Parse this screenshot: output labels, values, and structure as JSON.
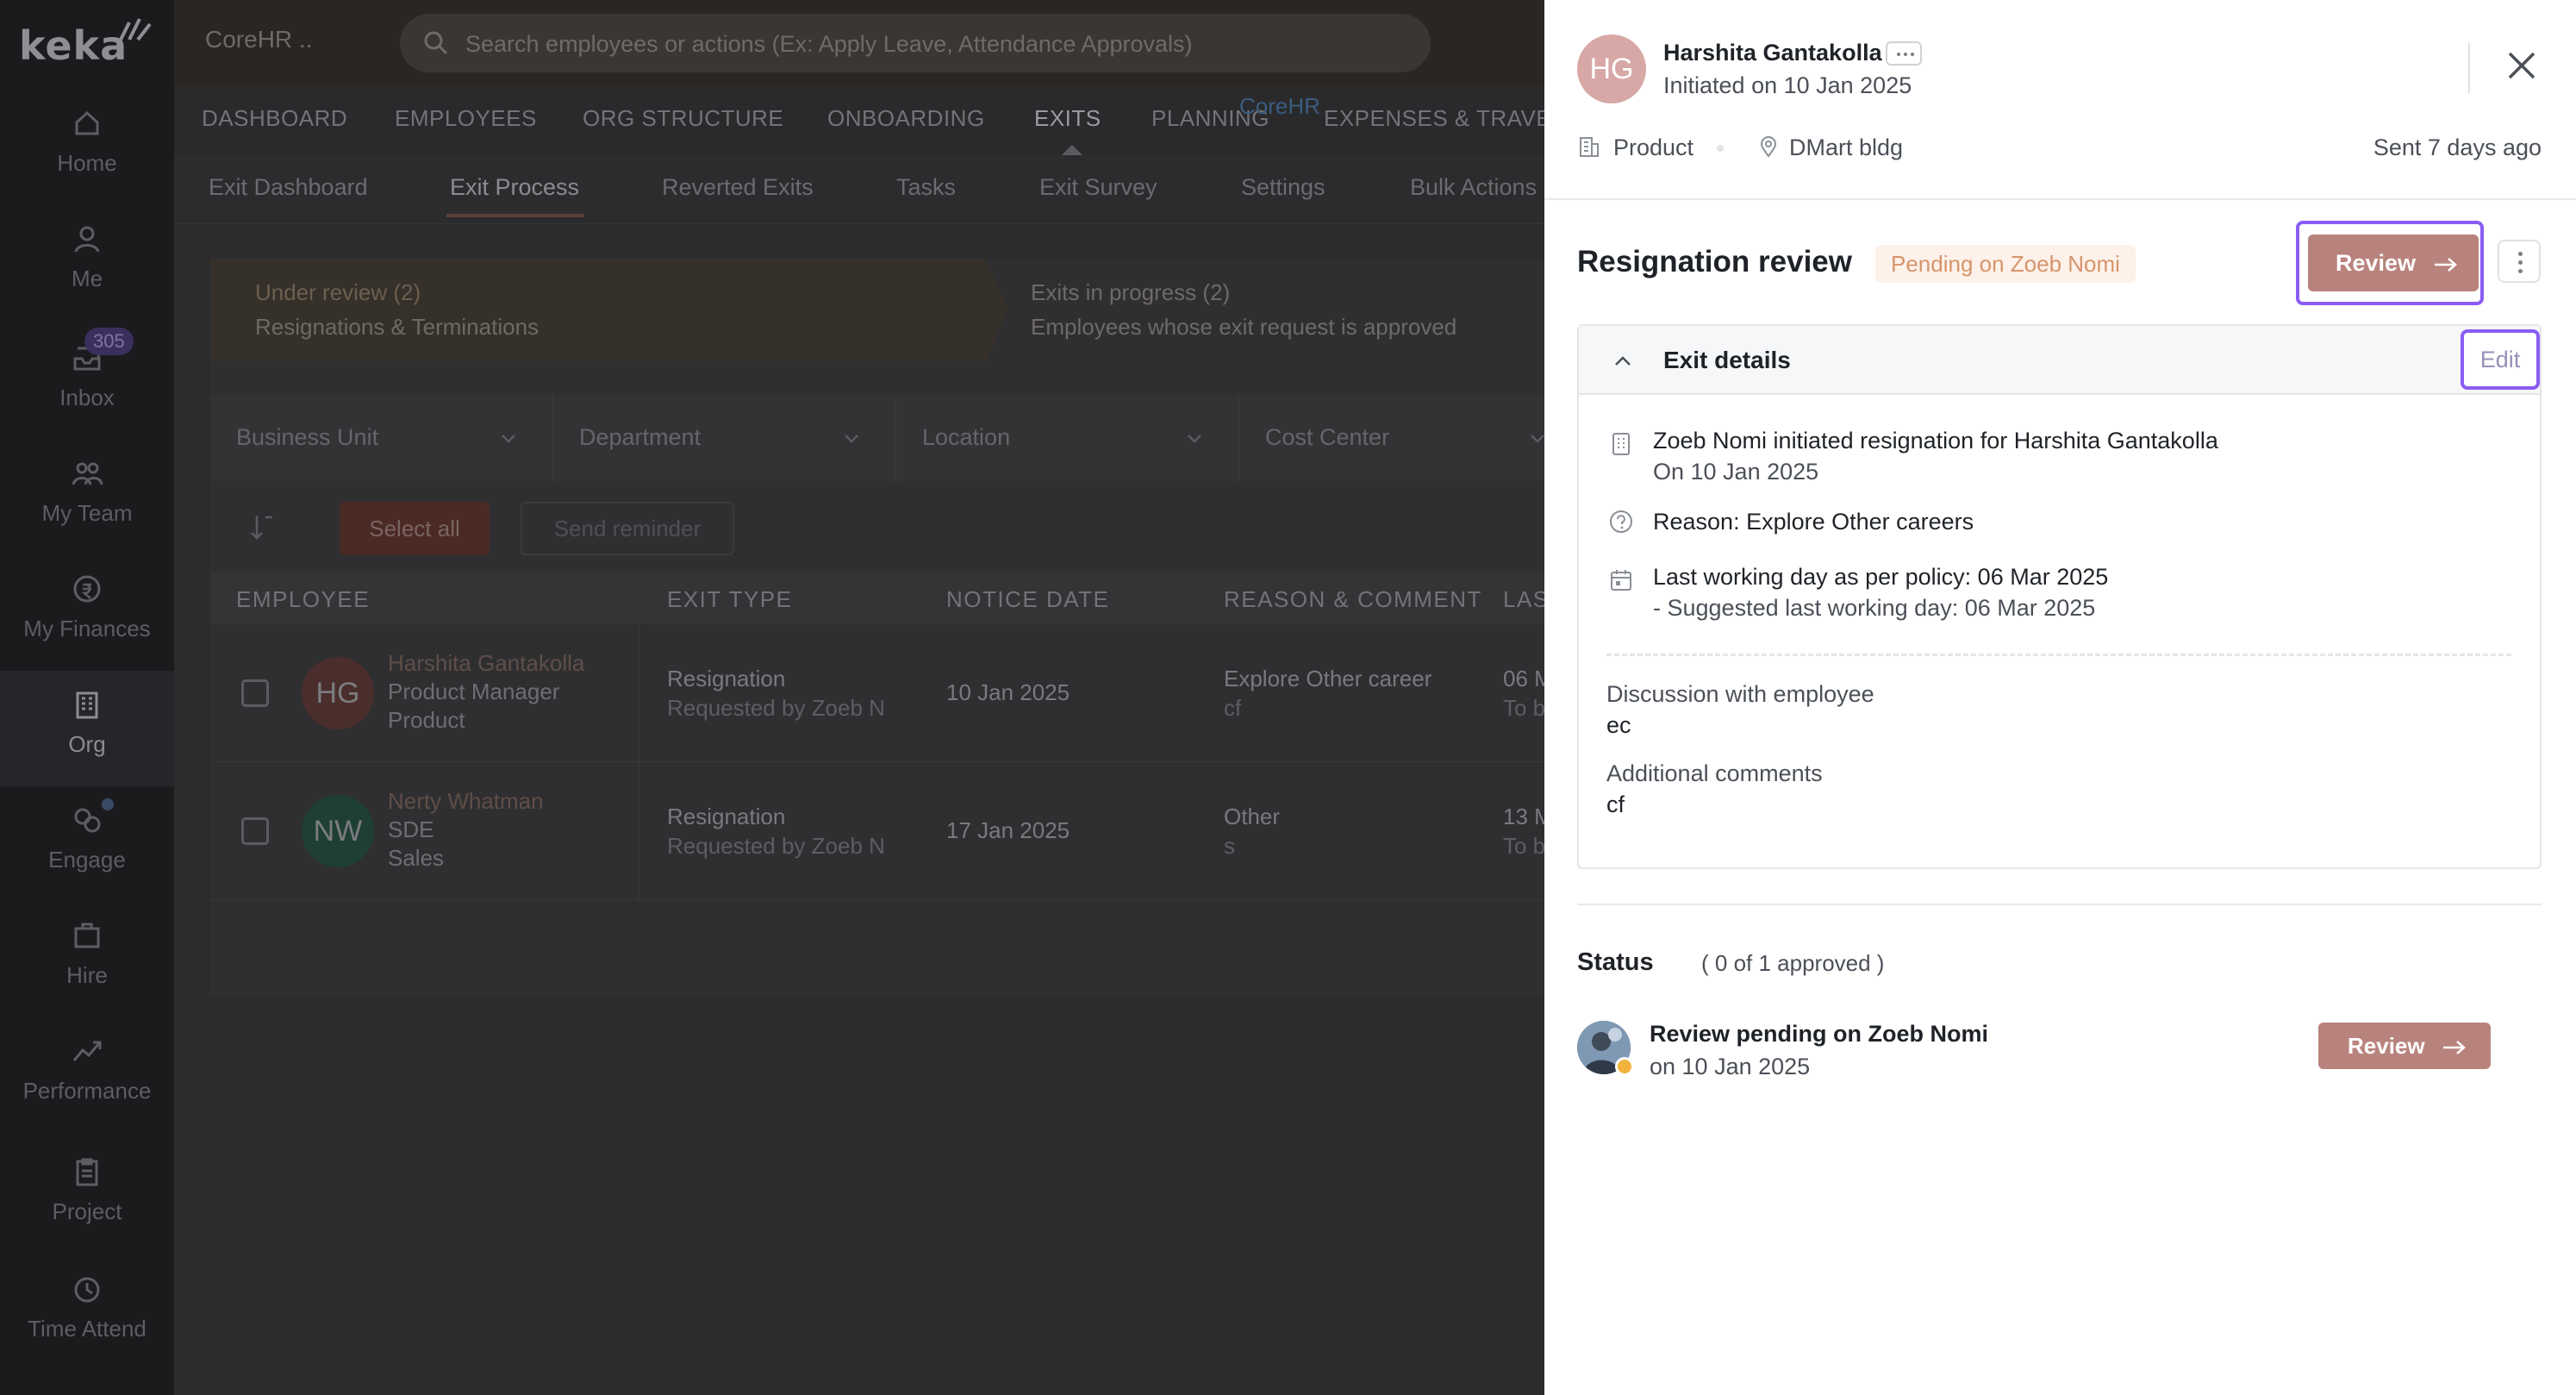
{
  "app": {
    "logo_text": "keka",
    "module_name": "CoreHR ..",
    "search_placeholder": "Search employees or actions (Ex: Apply Leave, Attendance Approvals)"
  },
  "rail": [
    {
      "label": "Home",
      "icon": "home-icon"
    },
    {
      "label": "Me",
      "icon": "user-icon"
    },
    {
      "label": "Inbox",
      "icon": "inbox-icon",
      "badge": "305"
    },
    {
      "label": "My Team",
      "icon": "team-icon"
    },
    {
      "label": "My Finances",
      "icon": "finance-icon"
    },
    {
      "label": "Org",
      "icon": "org-icon",
      "active": true
    },
    {
      "label": "Engage",
      "icon": "engage-icon"
    },
    {
      "label": "Hire",
      "icon": "hire-icon"
    },
    {
      "label": "Performance",
      "icon": "performance-icon"
    },
    {
      "label": "Project",
      "icon": "project-icon"
    },
    {
      "label": "Time Attend",
      "icon": "clock-icon"
    }
  ],
  "main_nav": {
    "items": [
      "DASHBOARD",
      "EMPLOYEES",
      "ORG STRUCTURE",
      "ONBOARDING",
      "EXITS",
      "PLANNING",
      "EXPENSES & TRAVEL"
    ],
    "active": "EXITS",
    "floating_label": "CoreHR"
  },
  "sub_nav": {
    "items": [
      "Exit Dashboard",
      "Exit Process",
      "Reverted Exits",
      "Tasks",
      "Exit Survey",
      "Settings",
      "Bulk Actions"
    ],
    "active": "Exit Process"
  },
  "stages": [
    {
      "title": "Under review (2)",
      "subtitle": "Resignations & Terminations"
    },
    {
      "title": "Exits in progress (2)",
      "subtitle": "Employees whose exit request is approved"
    }
  ],
  "filters": [
    "Business Unit",
    "Department",
    "Location",
    "Cost Center"
  ],
  "actions": {
    "select_all": "Select all",
    "send_reminder": "Send reminder"
  },
  "table": {
    "headers": [
      "EMPLOYEE",
      "EXIT TYPE",
      "NOTICE DATE",
      "REASON & COMMENT",
      "LAS"
    ],
    "rows": [
      {
        "initials": "HG",
        "name": "Harshita Gantakolla",
        "role": "Product Manager",
        "dept": "Product",
        "exit_type": "Resignation",
        "requested_by": "Requested by Zoeb N",
        "notice_date": "10 Jan 2025",
        "reason": "Explore Other career",
        "comment": "cf",
        "last_day": "06 M",
        "last_sub": "To b",
        "avatar_color": "#4a2e2c"
      },
      {
        "initials": "NW",
        "name": "Nerty Whatman",
        "role": "SDE",
        "dept": "Sales",
        "exit_type": "Resignation",
        "requested_by": "Requested by Zoeb N",
        "notice_date": "17 Jan 2025",
        "reason": "Other",
        "comment": "s",
        "last_day": "13 M",
        "last_sub": "To b",
        "avatar_color": "#1f3f34"
      }
    ]
  },
  "drawer": {
    "initials": "HG",
    "name": "Harshita Gantakolla",
    "initiated": "Initiated on 10 Jan 2025",
    "department": "Product",
    "location": "DMart bldg",
    "sent": "Sent 7 days ago",
    "review_title": "Resignation review",
    "pending_badge": "Pending on Zoeb Nomi",
    "review_button": "Review",
    "exit_details": {
      "title": "Exit details",
      "edit_label": "Edit",
      "initiated_line": "Zoeb Nomi initiated resignation for Harshita Gantakolla",
      "initiated_date": "On 10 Jan 2025",
      "reason": "Reason: Explore Other careers",
      "last_day": "Last working day as per policy: 06 Mar 2025",
      "suggested": "- Suggested last working day: 06 Mar 2025",
      "discussion_label": "Discussion with employee",
      "discussion_value": "ec",
      "comments_label": "Additional comments",
      "comments_value": "cf"
    },
    "status": {
      "title": "Status",
      "count": "( 0 of 1 approved )",
      "reviewer_line": "Review pending on Zoeb Nomi",
      "reviewer_date": "on 10 Jan 2025",
      "review_button": "Review"
    }
  },
  "colors": {
    "accent_brown": "#b9837d",
    "focus_purple": "#8b5cf6",
    "pending_text": "#d7956b",
    "pending_bg": "#fdf1ea"
  }
}
